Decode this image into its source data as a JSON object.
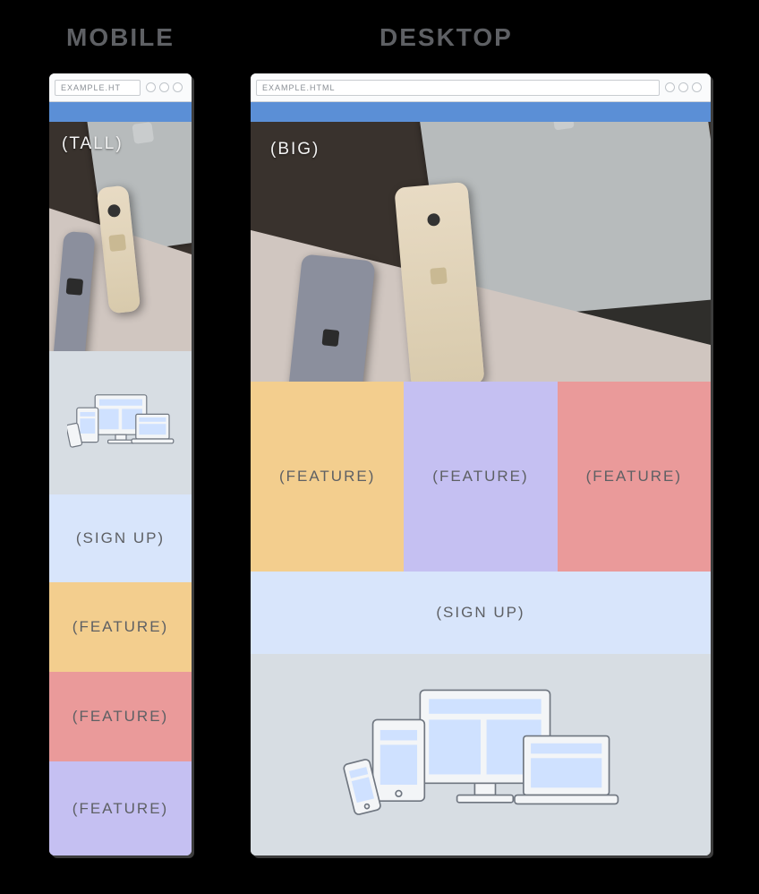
{
  "headings": {
    "mobile": "MOBILE",
    "desktop": "DESKTOP"
  },
  "browser": {
    "address_full": "EXAMPLE.HTML",
    "address_truncated": "EXAMPLE.HT"
  },
  "hero": {
    "tall_label": "(TALL)",
    "big_label": "(BIG)"
  },
  "sections": {
    "signup": "(SIGN UP)",
    "feature": "(FEATURE)"
  },
  "colors": {
    "header_bar": "#5b8fd6",
    "signup_bg": "#d8e5fb",
    "illus_bg": "#d7dde3",
    "feature_yellow": "#f3ce8e",
    "feature_purple": "#c5c0f2",
    "feature_red": "#ea9a9a"
  },
  "layout": {
    "mobile_sections_order": [
      "hero_tall",
      "illustration",
      "signup",
      "feature_yellow",
      "feature_red",
      "feature_purple"
    ],
    "desktop_sections_order": [
      "hero_big",
      "features_row(yellow,purple,red)",
      "signup",
      "illustration"
    ]
  }
}
